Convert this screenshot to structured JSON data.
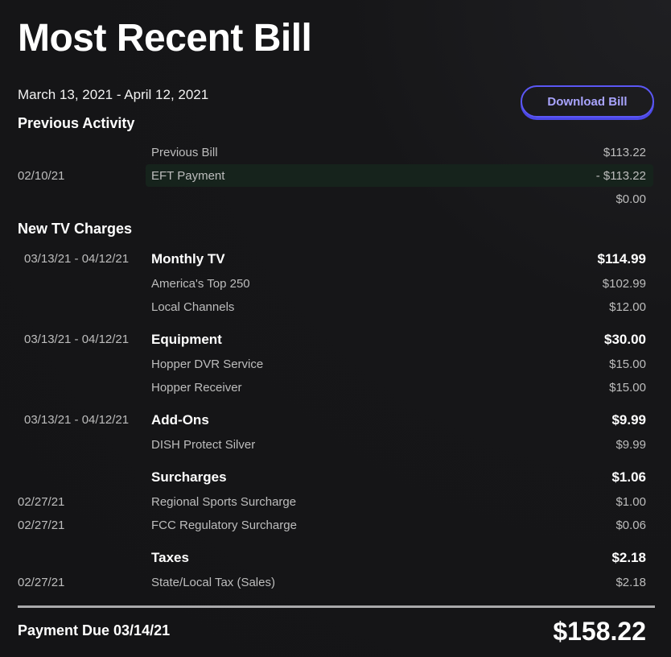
{
  "header": {
    "title": "Most Recent Bill",
    "period": "March 13, 2021 - April 12, 2021",
    "download_label": "Download Bill"
  },
  "previous_activity": {
    "heading": "Previous Activity",
    "rows": [
      {
        "date": "",
        "desc": "Previous Bill",
        "amount": "$113.22"
      },
      {
        "date": "02/10/21",
        "desc": "EFT Payment",
        "amount": "- $113.22"
      },
      {
        "date": "",
        "desc": "",
        "amount": "$0.00"
      }
    ]
  },
  "new_charges": {
    "heading": "New TV Charges",
    "groups": [
      {
        "date": "03/13/21 - 04/12/21",
        "label": "Monthly TV",
        "amount": "$114.99",
        "items": [
          {
            "date": "",
            "desc": "America's Top 250",
            "amount": "$102.99"
          },
          {
            "date": "",
            "desc": "Local Channels",
            "amount": "$12.00"
          }
        ]
      },
      {
        "date": "03/13/21 - 04/12/21",
        "label": "Equipment",
        "amount": "$30.00",
        "items": [
          {
            "date": "",
            "desc": "Hopper DVR Service",
            "amount": "$15.00"
          },
          {
            "date": "",
            "desc": "Hopper Receiver",
            "amount": "$15.00"
          }
        ]
      },
      {
        "date": "03/13/21 - 04/12/21",
        "label": "Add-Ons",
        "amount": "$9.99",
        "items": [
          {
            "date": "",
            "desc": "DISH Protect Silver",
            "amount": "$9.99"
          }
        ]
      },
      {
        "date": "",
        "label": "Surcharges",
        "amount": "$1.06",
        "items": [
          {
            "date": "02/27/21",
            "desc": "Regional Sports Surcharge",
            "amount": "$1.00"
          },
          {
            "date": "02/27/21",
            "desc": "FCC Regulatory Surcharge",
            "amount": "$0.06"
          }
        ]
      },
      {
        "date": "",
        "label": "Taxes",
        "amount": "$2.18",
        "items": [
          {
            "date": "02/27/21",
            "desc": "State/Local Tax (Sales)",
            "amount": "$2.18"
          }
        ]
      }
    ]
  },
  "footer": {
    "due_label": "Payment Due 03/14/21",
    "due_amount": "$158.22"
  },
  "colors": {
    "background": "#141416",
    "accent": "#5b57f5",
    "button_text": "#a9a4ff",
    "muted_text": "#bdbdbd",
    "highlight_row": "#16231c"
  }
}
